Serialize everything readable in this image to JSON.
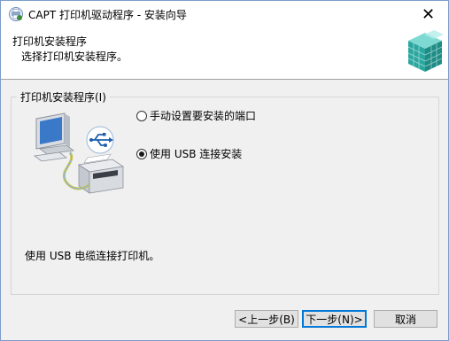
{
  "window": {
    "title": "CAPT 打印机驱动程序 - 安装向导",
    "close_glyph": "✕"
  },
  "header": {
    "title": "打印机安装程序",
    "subtitle": "选择打印机安装程序。"
  },
  "group": {
    "label": "打印机安装程序(I)",
    "options": [
      {
        "label": "手动设置要安装的端口",
        "selected": false
      },
      {
        "label": "使用 USB 连接安装",
        "selected": true
      }
    ],
    "description": "使用 USB 电缆连接打印机。"
  },
  "buttons": {
    "back": "<上一步(B)",
    "next": "下一步(N)>",
    "cancel": "取消"
  },
  "icons": {
    "app": "printer-driver-icon",
    "header": "install-cube-icon",
    "illustration": "usb-computer-printer-illustration"
  },
  "colors": {
    "accent": "#0078d7",
    "header_graphic": "#2fb5b0"
  }
}
